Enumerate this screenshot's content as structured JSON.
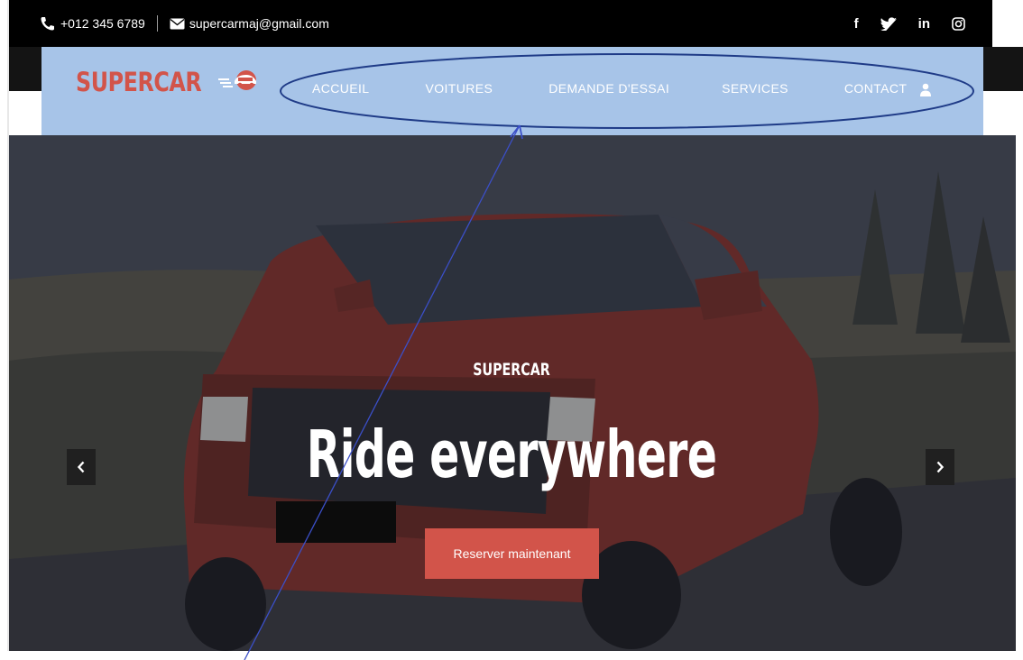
{
  "topbar": {
    "phone": "+012 345 6789",
    "email": "supercarmaj@gmail.com",
    "social": [
      "f",
      "in"
    ]
  },
  "nav": {
    "logo": "SUPERCAR",
    "items": [
      "ACCUEIL",
      "VOITURES",
      "DEMANDE D'ESSAI",
      "SERVICES",
      "CONTACT"
    ]
  },
  "hero": {
    "kicker": "SUPERCAR",
    "title": "Ride everywhere",
    "cta": "Reserver maintenant"
  },
  "colors": {
    "brand": "#d2544a",
    "nav_bg": "#a7c4e8",
    "annotation": "#1f3b87",
    "topbar_bg": "#000000"
  },
  "icons": [
    "phone-icon",
    "envelope-icon",
    "facebook-icon",
    "twitter-icon",
    "linkedin-icon",
    "instagram-icon",
    "user-icon",
    "chevron-left-icon",
    "chevron-right-icon"
  ]
}
